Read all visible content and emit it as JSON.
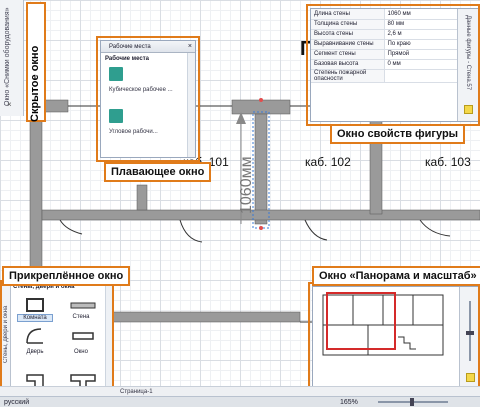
{
  "plan": {
    "rooms": [
      "каб. 101",
      "каб. 102",
      "каб. 103"
    ],
    "dimension": "1060мм",
    "title_partial": "П"
  },
  "callouts": {
    "hidden": "Скрытое окно",
    "floating": "Плавающее окно",
    "properties": "Окно свойств фигуры",
    "docked": "Прикреплённое окно",
    "panzoom": "Окно «Панорама и масштаб»"
  },
  "hidden_window": {
    "text": "Окно «Снимки оборудования»",
    "close": "×"
  },
  "floating_window": {
    "title": "Рабочие места",
    "stencil": "Рабочие места",
    "shapes": [
      "Кубическое рабочее ...",
      "Угловое рабочи..."
    ]
  },
  "properties_window": {
    "side_title": "Данные фигуры - Стена.57",
    "rows": [
      {
        "key": "Длина стены",
        "value": "1060 мм"
      },
      {
        "key": "Толщина стены",
        "value": "80 мм"
      },
      {
        "key": "Высота стены",
        "value": "2,6 м"
      },
      {
        "key": "Выравнивание стены",
        "value": "По краю"
      },
      {
        "key": "Сегмент стены",
        "value": "Прямой"
      },
      {
        "key": "Базовая высота",
        "value": "0 мм"
      },
      {
        "key": "Степень пожарной опасности",
        "value": ""
      }
    ]
  },
  "docked_window": {
    "side_title": "Стены, двери и окна",
    "header": "Стены, двери и окна",
    "shapes": [
      "Комната",
      "Стена",
      "Дверь",
      "Окно"
    ]
  },
  "page_tabs": {
    "page": "Страница-1"
  },
  "statusbar": {
    "language": "русский",
    "zoom": "165%"
  },
  "colors": {
    "accent": "#e07b1a",
    "wall": "#9a9a9a",
    "shape_teal": "#2f9e8f"
  }
}
